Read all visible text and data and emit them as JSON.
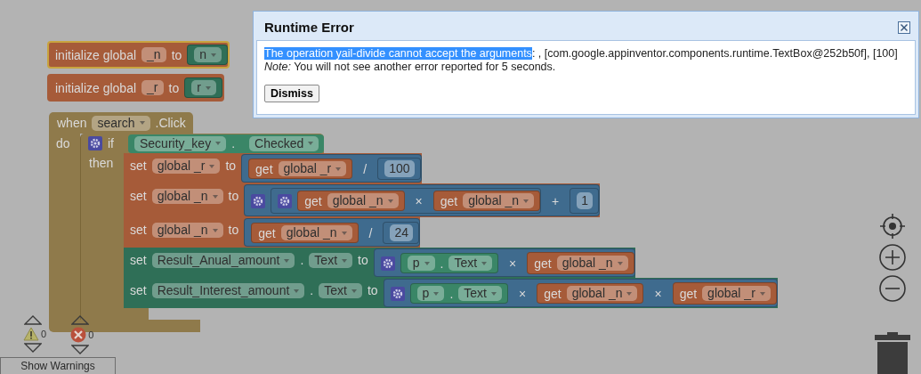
{
  "dialog": {
    "title": "Runtime Error",
    "message": [
      {
        "text": "The operation yail-divide cannot accept the arguments",
        "highlighted": true
      },
      {
        "text": ": , [com.google.appinventor.components.runtime.TextBox@252b50f], [100]",
        "highlighted": false
      }
    ],
    "note": "*Note:* You will not see another error reported for 5 seconds.",
    "button": "Dismiss"
  },
  "blocks": [
    {
      "kind": "variable",
      "selected": true,
      "head": [
        {
          "kind": "label",
          "text": "initialize global"
        },
        {
          "kind": "field",
          "text": "_n"
        },
        {
          "kind": "label",
          "text": "to"
        },
        {
          "kind": "block",
          "block": {
            "kind": "component",
            "head": [
              {
                "kind": "dropdown",
                "text": "n"
              }
            ]
          }
        }
      ]
    },
    {
      "kind": "variable",
      "selected": false,
      "head": [
        {
          "kind": "label",
          "text": "initialize global"
        },
        {
          "kind": "field",
          "text": "_r"
        },
        {
          "kind": "label",
          "text": "to"
        },
        {
          "kind": "block",
          "block": {
            "kind": "component",
            "head": [
              {
                "kind": "dropdown",
                "text": "r"
              }
            ]
          }
        }
      ]
    },
    {
      "kind": "event",
      "selected": false,
      "head": [
        {
          "kind": "label",
          "text": "when"
        },
        {
          "kind": "dropdown",
          "text": "search"
        },
        {
          "kind": "label",
          "text": ".Click"
        }
      ],
      "slots": [
        {
          "label": "do",
          "statements": [
            {
              "kind": "control",
              "head": [
                {
                  "kind": "gear"
                },
                {
                  "kind": "label",
                  "text": "if"
                },
                {
                  "kind": "block",
                  "block": {
                    "kind": "component",
                    "head": [
                      {
                        "kind": "dropdown",
                        "text": "Security_key"
                      },
                      {
                        "kind": "label",
                        "text": "."
                      },
                      {
                        "kind": "dropdown",
                        "text": "Checked"
                      }
                    ]
                  }
                }
              ],
              "slots": [
                {
                  "label": "then",
                  "statements": [
                    {
                      "kind": "variable",
                      "head": [
                        {
                          "kind": "label",
                          "text": "set"
                        },
                        {
                          "kind": "dropdown",
                          "text": "global _r"
                        },
                        {
                          "kind": "label",
                          "text": "to"
                        },
                        {
                          "kind": "block",
                          "block": {
                            "kind": "math",
                            "head": [
                              {
                                "kind": "block",
                                "block": {
                                  "kind": "variable",
                                  "head": [
                                    {
                                      "kind": "label",
                                      "text": "get"
                                    },
                                    {
                                      "kind": "dropdown",
                                      "text": "global _r"
                                    }
                                  ]
                                }
                              },
                              {
                                "kind": "op",
                                "text": "/"
                              },
                              {
                                "kind": "block",
                                "block": {
                                  "kind": "math",
                                  "head": [
                                    {
                                      "kind": "number",
                                      "text": "100"
                                    }
                                  ]
                                }
                              }
                            ]
                          }
                        }
                      ]
                    },
                    {
                      "kind": "variable",
                      "head": [
                        {
                          "kind": "label",
                          "text": "set"
                        },
                        {
                          "kind": "dropdown",
                          "text": "global _n"
                        },
                        {
                          "kind": "label",
                          "text": "to"
                        },
                        {
                          "kind": "block",
                          "block": {
                            "kind": "math",
                            "head": [
                              {
                                "kind": "gear"
                              },
                              {
                                "kind": "block",
                                "block": {
                                  "kind": "math",
                                  "head": [
                                    {
                                      "kind": "gear"
                                    },
                                    {
                                      "kind": "block",
                                      "block": {
                                        "kind": "variable",
                                        "head": [
                                          {
                                            "kind": "label",
                                            "text": "get"
                                          },
                                          {
                                            "kind": "dropdown",
                                            "text": "global _n"
                                          }
                                        ]
                                      }
                                    },
                                    {
                                      "kind": "op",
                                      "text": "×"
                                    },
                                    {
                                      "kind": "block",
                                      "block": {
                                        "kind": "variable",
                                        "head": [
                                          {
                                            "kind": "label",
                                            "text": "get"
                                          },
                                          {
                                            "kind": "dropdown",
                                            "text": "global _n"
                                          }
                                        ]
                                      }
                                    }
                                  ]
                                }
                              },
                              {
                                "kind": "op",
                                "text": "+"
                              },
                              {
                                "kind": "block",
                                "block": {
                                  "kind": "math",
                                  "head": [
                                    {
                                      "kind": "number",
                                      "text": "1"
                                    }
                                  ]
                                }
                              }
                            ]
                          }
                        }
                      ]
                    },
                    {
                      "kind": "variable",
                      "head": [
                        {
                          "kind": "label",
                          "text": "set"
                        },
                        {
                          "kind": "dropdown",
                          "text": "global _n"
                        },
                        {
                          "kind": "label",
                          "text": "to"
                        },
                        {
                          "kind": "block",
                          "block": {
                            "kind": "math",
                            "head": [
                              {
                                "kind": "block",
                                "block": {
                                  "kind": "variable",
                                  "head": [
                                    {
                                      "kind": "label",
                                      "text": "get"
                                    },
                                    {
                                      "kind": "dropdown",
                                      "text": "global _n"
                                    }
                                  ]
                                }
                              },
                              {
                                "kind": "op",
                                "text": "/"
                              },
                              {
                                "kind": "block",
                                "block": {
                                  "kind": "math",
                                  "head": [
                                    {
                                      "kind": "number",
                                      "text": "24"
                                    }
                                  ]
                                }
                              }
                            ]
                          }
                        }
                      ]
                    },
                    {
                      "kind": "component",
                      "head": [
                        {
                          "kind": "label",
                          "text": "set"
                        },
                        {
                          "kind": "dropdown",
                          "text": "Result_Anual_amount"
                        },
                        {
                          "kind": "label",
                          "text": "."
                        },
                        {
                          "kind": "dropdown",
                          "text": "Text"
                        },
                        {
                          "kind": "label",
                          "text": "to"
                        },
                        {
                          "kind": "block",
                          "block": {
                            "kind": "math",
                            "head": [
                              {
                                "kind": "gear"
                              },
                              {
                                "kind": "block",
                                "block": {
                                  "kind": "component",
                                  "head": [
                                    {
                                      "kind": "dropdown",
                                      "text": "p"
                                    },
                                    {
                                      "kind": "label",
                                      "text": "."
                                    },
                                    {
                                      "kind": "dropdown",
                                      "text": "Text"
                                    }
                                  ]
                                }
                              },
                              {
                                "kind": "op",
                                "text": "×"
                              },
                              {
                                "kind": "block",
                                "block": {
                                  "kind": "variable",
                                  "head": [
                                    {
                                      "kind": "label",
                                      "text": "get"
                                    },
                                    {
                                      "kind": "dropdown",
                                      "text": "global _n"
                                    }
                                  ]
                                }
                              }
                            ]
                          }
                        }
                      ]
                    },
                    {
                      "kind": "component",
                      "head": [
                        {
                          "kind": "label",
                          "text": "set"
                        },
                        {
                          "kind": "dropdown",
                          "text": "Result_Interest_amount"
                        },
                        {
                          "kind": "label",
                          "text": "."
                        },
                        {
                          "kind": "dropdown",
                          "text": "Text"
                        },
                        {
                          "kind": "label",
                          "text": "to"
                        },
                        {
                          "kind": "block",
                          "block": {
                            "kind": "math",
                            "head": [
                              {
                                "kind": "gear"
                              },
                              {
                                "kind": "block",
                                "block": {
                                  "kind": "component",
                                  "head": [
                                    {
                                      "kind": "dropdown",
                                      "text": "p"
                                    },
                                    {
                                      "kind": "label",
                                      "text": "."
                                    },
                                    {
                                      "kind": "dropdown",
                                      "text": "Text"
                                    }
                                  ]
                                }
                              },
                              {
                                "kind": "op",
                                "text": "×"
                              },
                              {
                                "kind": "block",
                                "block": {
                                  "kind": "variable",
                                  "head": [
                                    {
                                      "kind": "label",
                                      "text": "get"
                                    },
                                    {
                                      "kind": "dropdown",
                                      "text": "global _n"
                                    }
                                  ]
                                }
                              },
                              {
                                "kind": "op",
                                "text": "×"
                              },
                              {
                                "kind": "block",
                                "block": {
                                  "kind": "variable",
                                  "head": [
                                    {
                                      "kind": "label",
                                      "text": "get"
                                    },
                                    {
                                      "kind": "dropdown",
                                      "text": "global _r"
                                    }
                                  ]
                                }
                              }
                            ]
                          }
                        }
                      ]
                    }
                  ]
                }
              ]
            }
          ]
        }
      ]
    }
  ],
  "warnings": {
    "count": "0"
  },
  "errors": {
    "count": "0"
  },
  "show_warnings_button": "Show Warnings"
}
